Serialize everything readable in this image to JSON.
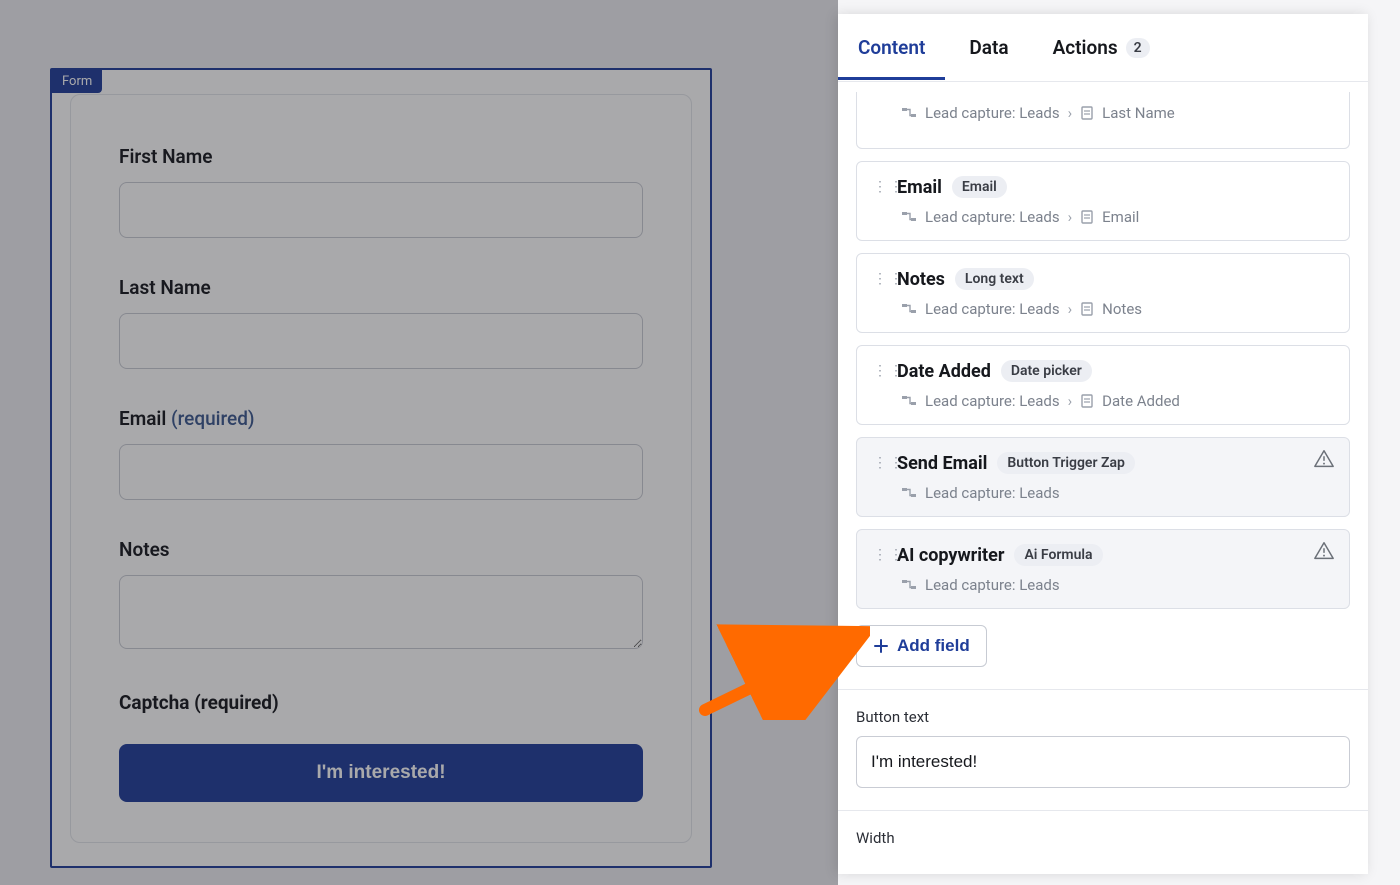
{
  "form": {
    "badge": "Form",
    "fields": [
      {
        "label": "First Name",
        "required": false,
        "type": "text"
      },
      {
        "label": "Last Name",
        "required": false,
        "type": "text"
      },
      {
        "label": "Email",
        "required": true,
        "type": "text"
      },
      {
        "label": "Notes",
        "required": false,
        "type": "textarea"
      }
    ],
    "captcha_label": "Captcha (required)",
    "required_suffix": "(required)",
    "submit_label": "I'm interested!"
  },
  "panel": {
    "tabs": [
      {
        "label": "Content",
        "active": true
      },
      {
        "label": "Data",
        "active": false
      },
      {
        "label": "Actions",
        "active": false,
        "badge": "2"
      }
    ],
    "partial_first_row": {
      "source_app": "Lead capture: Leads",
      "source_field": "Last Name"
    },
    "field_rows": [
      {
        "title": "Email",
        "type": "Email",
        "source_app": "Lead capture: Leads",
        "source_field": "Email",
        "muted": false,
        "warn": false
      },
      {
        "title": "Notes",
        "type": "Long text",
        "source_app": "Lead capture: Leads",
        "source_field": "Notes",
        "muted": false,
        "warn": false
      },
      {
        "title": "Date Added",
        "type": "Date picker",
        "source_app": "Lead capture: Leads",
        "source_field": "Date Added",
        "muted": false,
        "warn": false
      },
      {
        "title": "Send Email",
        "type": "Button Trigger Zap",
        "source_app": "Lead capture: Leads",
        "source_field": "",
        "muted": true,
        "warn": true
      },
      {
        "title": "AI copywriter",
        "type": "Ai Formula",
        "source_app": "Lead capture: Leads",
        "source_field": "",
        "muted": true,
        "warn": true
      }
    ],
    "add_field_label": "Add field",
    "button_text_label": "Button text",
    "button_text_value": "I'm interested!",
    "width_label": "Width"
  }
}
